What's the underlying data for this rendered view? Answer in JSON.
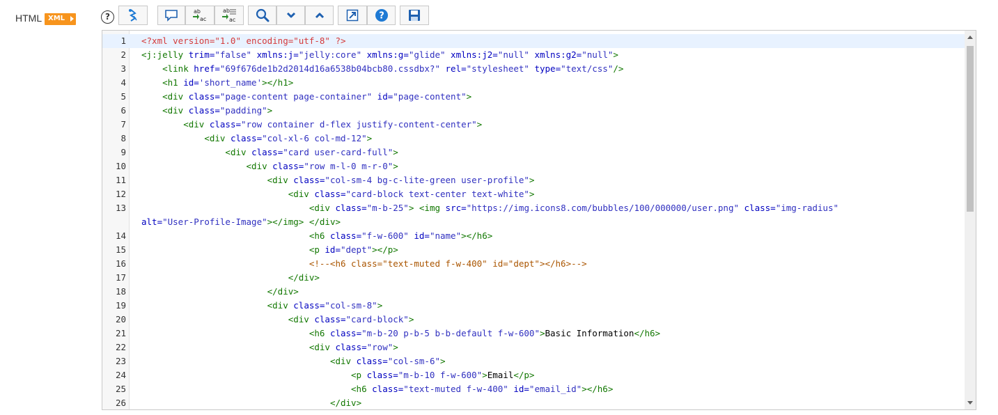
{
  "field": {
    "label": "HTML",
    "badge": "XML"
  },
  "toolbar": {
    "help": "?",
    "buttons": [
      {
        "name": "format-code-button",
        "icon": "format-icon"
      },
      {
        "name": "toggle-comment-button",
        "icon": "comment-icon"
      },
      {
        "name": "replace-button",
        "icon": "replace-icon"
      },
      {
        "name": "replace-all-button",
        "icon": "replace-all-icon"
      },
      {
        "name": "search-button",
        "icon": "search-icon"
      },
      {
        "name": "find-next-button",
        "icon": "chevron-down-icon"
      },
      {
        "name": "find-previous-button",
        "icon": "chevron-up-icon"
      },
      {
        "name": "fullscreen-button",
        "icon": "expand-icon"
      },
      {
        "name": "help-button",
        "icon": "help-icon"
      },
      {
        "name": "save-button",
        "icon": "save-icon"
      }
    ],
    "icon_labels": {
      "replace_top": "ab",
      "replace_bottom": "ac"
    }
  },
  "colors": {
    "accent": "#f7941d",
    "tag": "#117700",
    "attr": "#0000c0",
    "string": "#3030c0",
    "pi": "#d43a3a",
    "comment": "#aa5500"
  },
  "editor": {
    "lines": [
      {
        "n": "1",
        "tokens": [
          [
            "pi",
            "<?xml version=\"1.0\" encoding=\"utf-8\" ?>"
          ]
        ]
      },
      {
        "n": "2",
        "tokens": [
          [
            "tag",
            "<j:jelly "
          ],
          [
            "attr",
            "trim="
          ],
          [
            "str",
            "\"false\""
          ],
          [
            "attr",
            " xmlns:j="
          ],
          [
            "str",
            "\"jelly:core\""
          ],
          [
            "attr",
            " xmlns:g="
          ],
          [
            "str",
            "\"glide\""
          ],
          [
            "attr",
            " xmlns:j2="
          ],
          [
            "str",
            "\"null\""
          ],
          [
            "attr",
            " xmlns:g2="
          ],
          [
            "str",
            "\"null\""
          ],
          [
            "tag",
            ">"
          ]
        ]
      },
      {
        "n": "3",
        "tokens": [
          [
            "txt",
            "    "
          ],
          [
            "tag",
            "<link "
          ],
          [
            "attr",
            "href="
          ],
          [
            "str",
            "\"69f676de1b2d2014d16a6538b04bcb80.cssdbx?\""
          ],
          [
            "attr",
            " rel="
          ],
          [
            "str",
            "\"stylesheet\""
          ],
          [
            "attr",
            " type="
          ],
          [
            "str",
            "\"text/css\""
          ],
          [
            "tag",
            "/>"
          ]
        ]
      },
      {
        "n": "4",
        "tokens": [
          [
            "txt",
            "    "
          ],
          [
            "tag",
            "<h1 "
          ],
          [
            "attr",
            "id="
          ],
          [
            "str",
            "'short_name'"
          ],
          [
            "tag",
            "></h1>"
          ]
        ]
      },
      {
        "n": "5",
        "tokens": [
          [
            "txt",
            "    "
          ],
          [
            "tag",
            "<div "
          ],
          [
            "attr",
            "class="
          ],
          [
            "str",
            "\"page-content page-container\""
          ],
          [
            "attr",
            " id="
          ],
          [
            "str",
            "\"page-content\""
          ],
          [
            "tag",
            ">"
          ]
        ]
      },
      {
        "n": "6",
        "tokens": [
          [
            "txt",
            "    "
          ],
          [
            "tag",
            "<div "
          ],
          [
            "attr",
            "class="
          ],
          [
            "str",
            "\"padding\""
          ],
          [
            "tag",
            ">"
          ]
        ]
      },
      {
        "n": "7",
        "tokens": [
          [
            "txt",
            "        "
          ],
          [
            "tag",
            "<div "
          ],
          [
            "attr",
            "class="
          ],
          [
            "str",
            "\"row container d-flex justify-content-center\""
          ],
          [
            "tag",
            ">"
          ]
        ]
      },
      {
        "n": "8",
        "tokens": [
          [
            "txt",
            "            "
          ],
          [
            "tag",
            "<div "
          ],
          [
            "attr",
            "class="
          ],
          [
            "str",
            "\"col-xl-6 col-md-12\""
          ],
          [
            "tag",
            ">"
          ]
        ]
      },
      {
        "n": "9",
        "tokens": [
          [
            "txt",
            "                "
          ],
          [
            "tag",
            "<div "
          ],
          [
            "attr",
            "class="
          ],
          [
            "str",
            "\"card user-card-full\""
          ],
          [
            "tag",
            ">"
          ]
        ]
      },
      {
        "n": "10",
        "tokens": [
          [
            "txt",
            "                    "
          ],
          [
            "tag",
            "<div "
          ],
          [
            "attr",
            "class="
          ],
          [
            "str",
            "\"row m-l-0 m-r-0\""
          ],
          [
            "tag",
            ">"
          ]
        ]
      },
      {
        "n": "11",
        "tokens": [
          [
            "txt",
            "                        "
          ],
          [
            "tag",
            "<div "
          ],
          [
            "attr",
            "class="
          ],
          [
            "str",
            "\"col-sm-4 bg-c-lite-green user-profile\""
          ],
          [
            "tag",
            ">"
          ]
        ]
      },
      {
        "n": "12",
        "tokens": [
          [
            "txt",
            "                            "
          ],
          [
            "tag",
            "<div "
          ],
          [
            "attr",
            "class="
          ],
          [
            "str",
            "\"card-block text-center text-white\""
          ],
          [
            "tag",
            ">"
          ]
        ]
      },
      {
        "n": "13",
        "tokens": [
          [
            "txt",
            "                                "
          ],
          [
            "tag",
            "<div "
          ],
          [
            "attr",
            "class="
          ],
          [
            "str",
            "\"m-b-25\""
          ],
          [
            "tag",
            ">"
          ],
          [
            "txt",
            " "
          ],
          [
            "tag",
            "<img "
          ],
          [
            "attr",
            "src="
          ],
          [
            "str",
            "\"https://img.icons8.com/bubbles/100/000000/user.png\""
          ],
          [
            "attr",
            " class="
          ],
          [
            "str",
            "\"img-radius\""
          ]
        ]
      },
      {
        "n": "",
        "tokens": [
          [
            "attr",
            "alt="
          ],
          [
            "str",
            "\"User-Profile-Image\""
          ],
          [
            "tag",
            "></img>"
          ],
          [
            "txt",
            " "
          ],
          [
            "tag",
            "</div>"
          ]
        ]
      },
      {
        "n": "14",
        "tokens": [
          [
            "txt",
            "                                "
          ],
          [
            "tag",
            "<h6 "
          ],
          [
            "attr",
            "class="
          ],
          [
            "str",
            "\"f-w-600\""
          ],
          [
            "attr",
            " id="
          ],
          [
            "str",
            "\"name\""
          ],
          [
            "tag",
            "></h6>"
          ]
        ]
      },
      {
        "n": "15",
        "tokens": [
          [
            "txt",
            "                                "
          ],
          [
            "tag",
            "<p "
          ],
          [
            "attr",
            "id="
          ],
          [
            "str",
            "\"dept\""
          ],
          [
            "tag",
            "></p>"
          ]
        ]
      },
      {
        "n": "16",
        "tokens": [
          [
            "txt",
            "                                "
          ],
          [
            "cm",
            "<!--<h6 class=\"text-muted f-w-400\" id=\"dept\"></h6>-->"
          ]
        ]
      },
      {
        "n": "17",
        "tokens": [
          [
            "txt",
            "                            "
          ],
          [
            "tag",
            "</div>"
          ]
        ]
      },
      {
        "n": "18",
        "tokens": [
          [
            "txt",
            "                        "
          ],
          [
            "tag",
            "</div>"
          ]
        ]
      },
      {
        "n": "19",
        "tokens": [
          [
            "txt",
            "                        "
          ],
          [
            "tag",
            "<div "
          ],
          [
            "attr",
            "class="
          ],
          [
            "str",
            "\"col-sm-8\""
          ],
          [
            "tag",
            ">"
          ]
        ]
      },
      {
        "n": "20",
        "tokens": [
          [
            "txt",
            "                            "
          ],
          [
            "tag",
            "<div "
          ],
          [
            "attr",
            "class="
          ],
          [
            "str",
            "\"card-block\""
          ],
          [
            "tag",
            ">"
          ]
        ]
      },
      {
        "n": "21",
        "tokens": [
          [
            "txt",
            "                                "
          ],
          [
            "tag",
            "<h6 "
          ],
          [
            "attr",
            "class="
          ],
          [
            "str",
            "\"m-b-20 p-b-5 b-b-default f-w-600\""
          ],
          [
            "tag",
            ">"
          ],
          [
            "txt",
            "Basic Information"
          ],
          [
            "tag",
            "</h6>"
          ]
        ]
      },
      {
        "n": "22",
        "tokens": [
          [
            "txt",
            "                                "
          ],
          [
            "tag",
            "<div "
          ],
          [
            "attr",
            "class="
          ],
          [
            "str",
            "\"row\""
          ],
          [
            "tag",
            ">"
          ]
        ]
      },
      {
        "n": "23",
        "tokens": [
          [
            "txt",
            "                                    "
          ],
          [
            "tag",
            "<div "
          ],
          [
            "attr",
            "class="
          ],
          [
            "str",
            "\"col-sm-6\""
          ],
          [
            "tag",
            ">"
          ]
        ]
      },
      {
        "n": "24",
        "tokens": [
          [
            "txt",
            "                                        "
          ],
          [
            "tag",
            "<p "
          ],
          [
            "attr",
            "class="
          ],
          [
            "str",
            "\"m-b-10 f-w-600\""
          ],
          [
            "tag",
            ">"
          ],
          [
            "txt",
            "Email"
          ],
          [
            "tag",
            "</p>"
          ]
        ]
      },
      {
        "n": "25",
        "tokens": [
          [
            "txt",
            "                                        "
          ],
          [
            "tag",
            "<h6 "
          ],
          [
            "attr",
            "class="
          ],
          [
            "str",
            "\"text-muted f-w-400\""
          ],
          [
            "attr",
            " id="
          ],
          [
            "str",
            "\"email_id\""
          ],
          [
            "tag",
            "></h6>"
          ]
        ]
      },
      {
        "n": "26",
        "tokens": [
          [
            "txt",
            "                                    "
          ],
          [
            "tag",
            "</div>"
          ]
        ]
      }
    ]
  }
}
